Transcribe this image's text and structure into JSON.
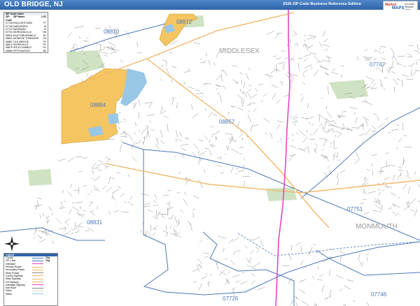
{
  "header": {
    "title": "OLD BRIDGE, NJ",
    "edition": "2026 ZIP Code Business Reference Edition"
  },
  "logo": {
    "brand_top": "Market",
    "brand_mid": "MAPS",
    "tag": "Accurate Reliable Maps"
  },
  "colors": {
    "header": "#2f64a8",
    "zip_area": "#f5c561",
    "water": "#99c7e6",
    "boundary": "#4b79b8",
    "highway": "#e845c2",
    "major_road": "#f2b76b",
    "park": "#cfe2c2"
  },
  "map_labels": {
    "counties": [
      "MIDDLESEX",
      "MONMOUTH"
    ],
    "zips": [
      "08810",
      "08872",
      "07747",
      "08884",
      "08857",
      "07751",
      "08831",
      "07726",
      "07746"
    ]
  },
  "zip_index": {
    "title": "ZIP Code Index",
    "headers": [
      "ZIP Code",
      "ZIP Name",
      "LOC"
    ],
    "rows": [
      [
        "07726",
        "ENGLISHTOWN",
        "F7"
      ],
      [
        "07746",
        "MARLBORO",
        "I8"
      ],
      [
        "07747",
        "MATAWAN",
        "I3"
      ],
      [
        "07751",
        "MORGANVILLE",
        "H6"
      ],
      [
        "08810",
        "EAST BRUNSWICK",
        "B1"
      ],
      [
        "08831",
        "MONROE TOWNSHIP",
        "C8"
      ],
      [
        "08857",
        "OLD BRIDGE",
        "F4"
      ],
      [
        "08872",
        "SAYREVILLE",
        "E1"
      ],
      [
        "08879",
        "SOUTH AMBOY",
        "H1"
      ],
      [
        "08884",
        "SPOTSWOOD",
        "B3"
      ]
    ]
  },
  "legend": {
    "title": "Legend",
    "rows": [
      {
        "name": "County",
        "sample": "City"
      },
      {
        "name": "ZIP Code",
        "sample": "City"
      },
      {
        "name": "Interstate",
        "sample": ""
      },
      {
        "name": "Primary Roads",
        "sample": ""
      },
      {
        "name": "Secondary Roads",
        "sample": ""
      },
      {
        "name": "Minor Roads",
        "sample": ""
      },
      {
        "name": "County Highway",
        "sample": ""
      },
      {
        "name": "State Highway",
        "sample": ""
      },
      {
        "name": "US Highway",
        "sample": ""
      },
      {
        "name": "Interstate Highway",
        "sample": ""
      },
      {
        "name": "Rail Road",
        "sample": ""
      },
      {
        "name": "Parks",
        "sample": ""
      },
      {
        "name": "Water",
        "sample": ""
      }
    ]
  }
}
